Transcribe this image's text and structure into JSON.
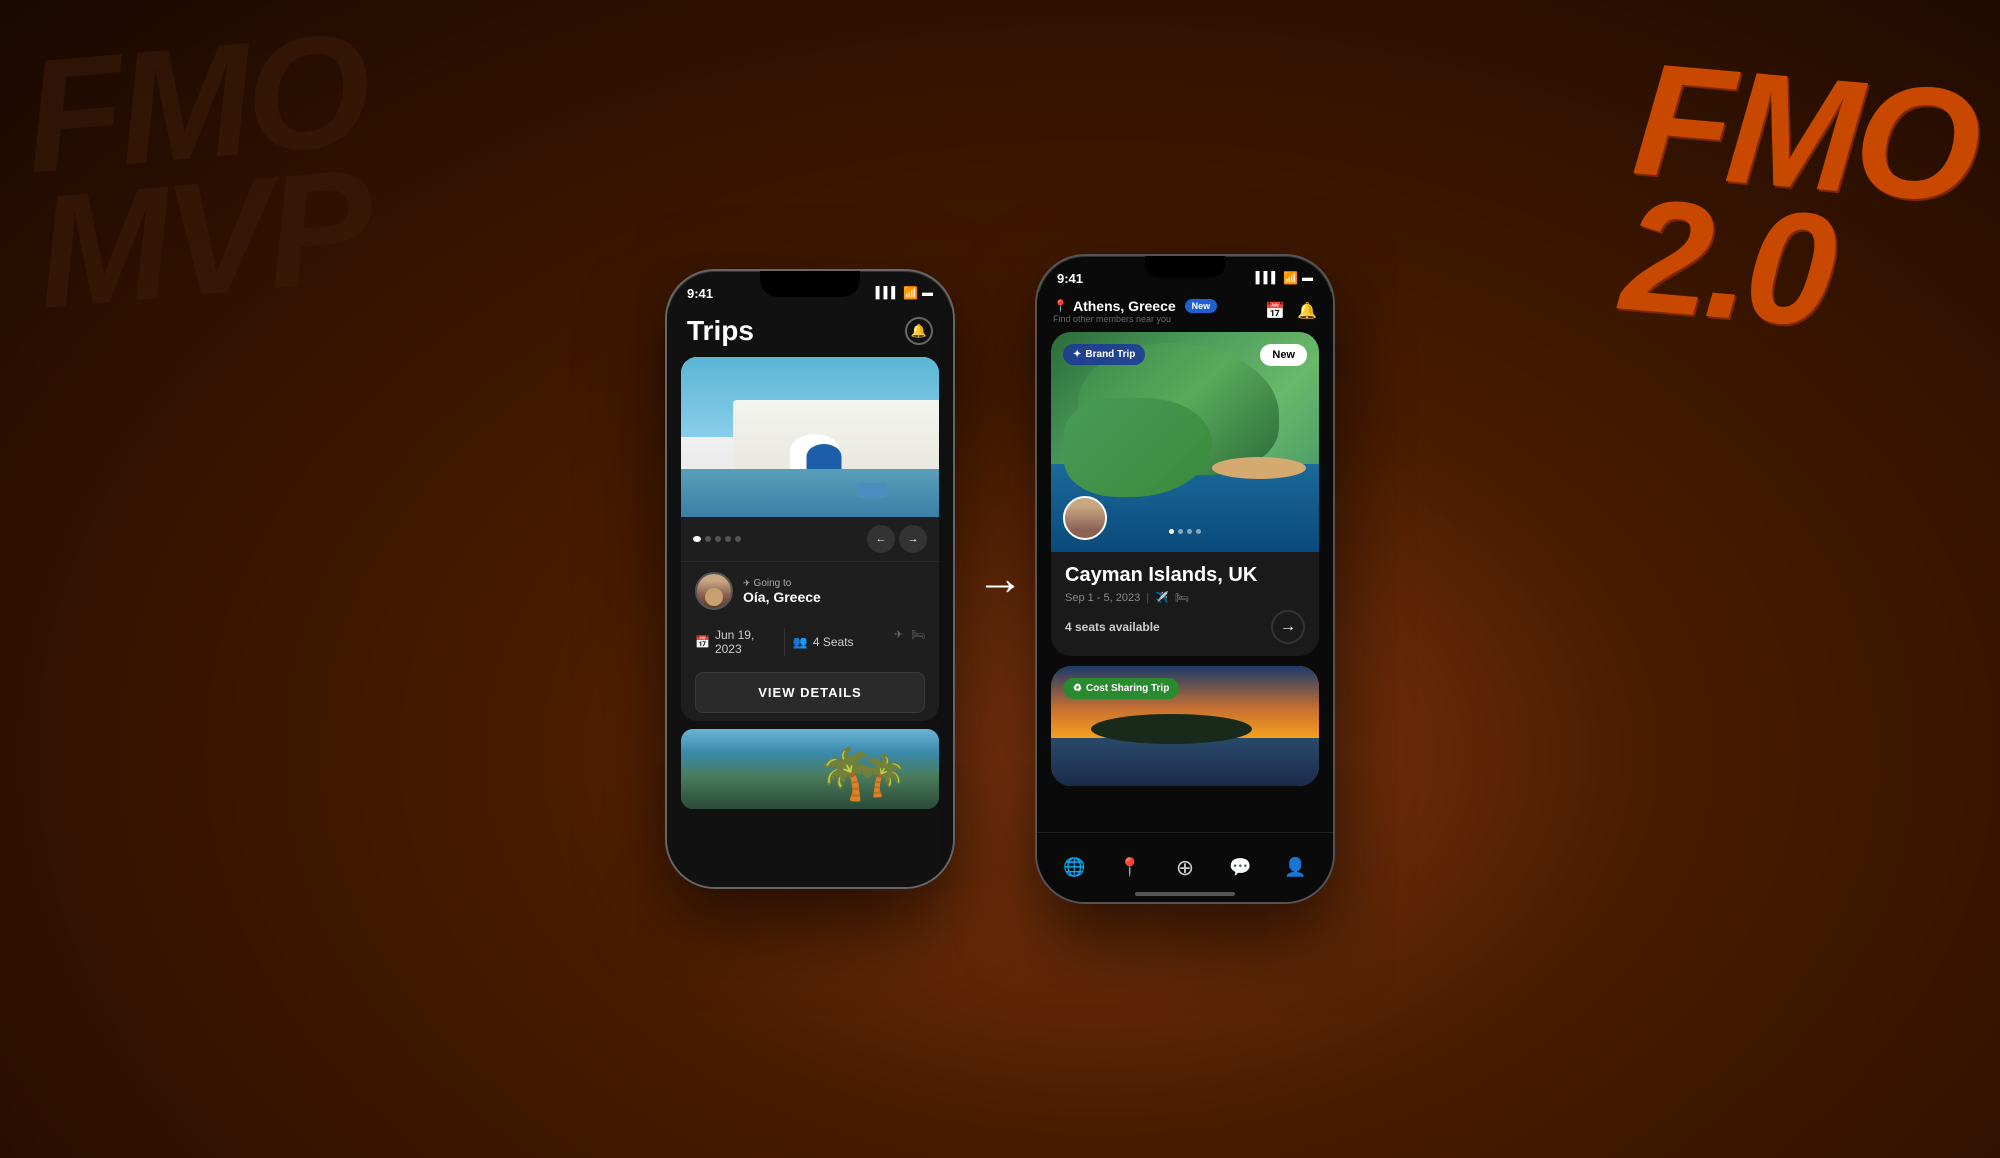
{
  "background": {
    "gradient": "radial brown to dark"
  },
  "watermark_left": {
    "line1": "FMO",
    "line2": "MVP"
  },
  "watermark_right": {
    "line1": "FMO",
    "line2": "2.0"
  },
  "arrow": "→",
  "phone1": {
    "status_bar": {
      "time": "9:41",
      "signal": "▌▌▌",
      "wifi": "wifi",
      "battery": "battery"
    },
    "header": {
      "title": "Trips",
      "bell_label": "🔔"
    },
    "trip_card_1": {
      "going_to_label": "Going to",
      "destination": "Oía, Greece",
      "date_icon": "📅",
      "date": "Jun 19, 2023",
      "seats_icon": "👥",
      "seats": "4 Seats",
      "view_details": "VIEW DETAILS"
    },
    "dots": [
      "active",
      "",
      "",
      "",
      ""
    ],
    "second_card_alt": "Beach with palm trees"
  },
  "phone2": {
    "status_bar": {
      "time": "9:41",
      "signal": "▌▌▌",
      "wifi": "wifi",
      "battery": "battery"
    },
    "header": {
      "location": "Athens, Greece",
      "new_badge": "New",
      "sub": "Find other members near you",
      "calendar_icon": "📅",
      "bell_icon": "🔔"
    },
    "main_card": {
      "brand_badge": "Brand Trip",
      "new_badge": "New",
      "image_alt": "Cayman Islands aerial view",
      "title": "Cayman Islands, UK",
      "dates": "Sep 1 - 5, 2023",
      "transport_icons": [
        "✈️",
        "🛏"
      ],
      "seats_available": "4 seats available",
      "dot_count": 4,
      "active_dot": 0
    },
    "cost_sharing_card": {
      "badge": "Cost Sharing Trip",
      "image_alt": "Sunset over water"
    },
    "bottom_nav": {
      "items": [
        "🌐",
        "📍",
        "➕",
        "💬",
        "👤"
      ]
    }
  }
}
